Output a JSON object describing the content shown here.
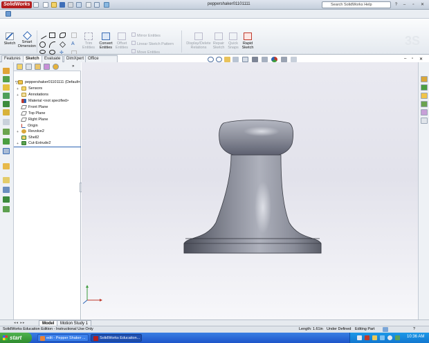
{
  "app": {
    "logo_text": "SolidWorks",
    "document_title": "peppershaker01101111",
    "search_placeholder": "Search SolidWorks Help"
  },
  "command_manager": {
    "sketch_label": "Sketch",
    "smart_dimension_label": "Smart Dimension",
    "trim_entities_label": "Trim Entities",
    "convert_entities_label": "Convert Entities",
    "offset_entities_label": "Offset Entities",
    "mirror_entities_label": "Mirror Entities",
    "linear_sketch_pattern_label": "Linear Sketch Pattern",
    "move_entities_label": "Move Entities",
    "display_delete_relations_label": "Display/Delete Relations",
    "repair_sketch_label": "Repair Sketch",
    "quick_snaps_label": "Quick Snaps",
    "rapid_sketch_label": "Rapid Sketch"
  },
  "tabs": [
    {
      "label": "Features"
    },
    {
      "label": "Sketch"
    },
    {
      "label": "Evaluate"
    },
    {
      "label": "DimXpert"
    },
    {
      "label": "Office Products"
    }
  ],
  "feature_tree": {
    "root": "peppershaker01101111 (Default<",
    "items": [
      {
        "label": "Sensors"
      },
      {
        "label": "Annotations"
      },
      {
        "label": "Material <not specified>"
      },
      {
        "label": "Front Plane"
      },
      {
        "label": "Top Plane"
      },
      {
        "label": "Right Plane"
      },
      {
        "label": "Origin"
      },
      {
        "label": "Revolve2"
      },
      {
        "label": "Shell2"
      },
      {
        "label": "Cut-Extrude2"
      }
    ]
  },
  "model_tabs": [
    {
      "label": "Model"
    },
    {
      "label": "Motion Study 1"
    }
  ],
  "status_bar": {
    "left": "SolidWorks Education Edition - Instructional Use Only",
    "length": "Length: 1.61in",
    "definition": "Under Defined",
    "mode": "Editing Part",
    "help": "?"
  },
  "taskbar": {
    "start_label": "start",
    "buttons": [
      {
        "label": "edit - Pepper Shaker ..."
      },
      {
        "label": "SolidWorks Education..."
      }
    ],
    "clock": "10:36 AM"
  },
  "colors": {
    "model_body": "#8a8d99",
    "viewport_bg": "#e4e4ec",
    "accent_red": "#b41e1e"
  }
}
